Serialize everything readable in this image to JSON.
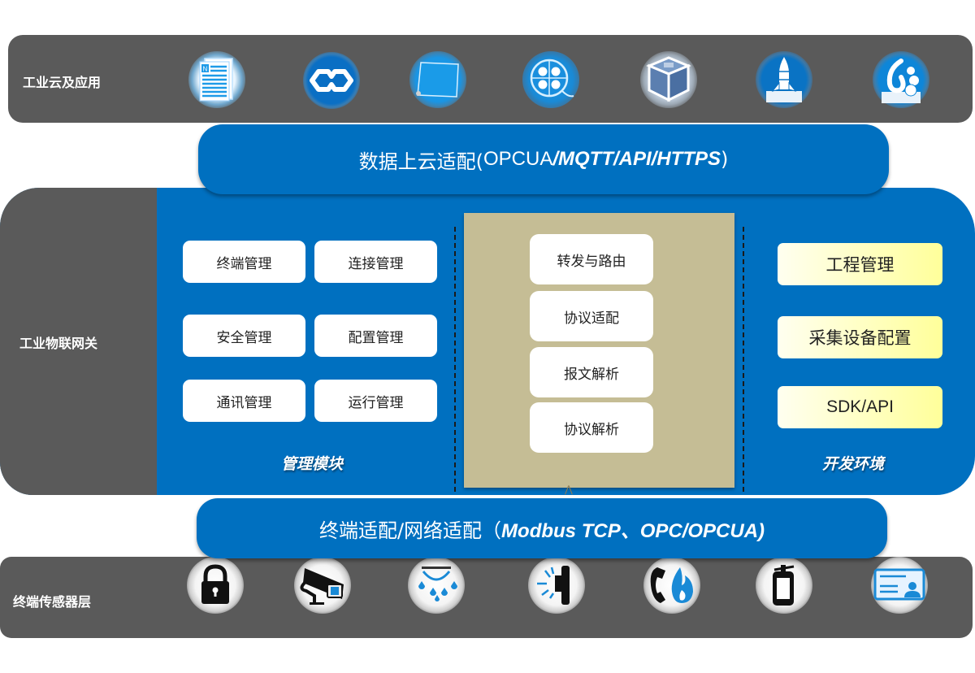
{
  "layers": {
    "cloud": {
      "label": "工业云及应用",
      "icons": [
        {
          "name": "document-icon",
          "glyph": "N"
        },
        {
          "name": "infinity-link-icon",
          "glyph": "∞"
        },
        {
          "name": "blue-screen-icon",
          "glyph": ""
        },
        {
          "name": "film-reel-icon",
          "glyph": ""
        },
        {
          "name": "virtualbox-cube-icon",
          "glyph": ""
        },
        {
          "name": "rocket-launcher-icon",
          "glyph": ""
        },
        {
          "name": "objectdock-icon",
          "glyph": ""
        }
      ]
    },
    "cloud_adapter": {
      "prefix": "数据上云适配(",
      "plain": "OPCUA",
      "italic": "/MQTT/API/HTTPS",
      "suffix": ")"
    },
    "gateway": {
      "label": "工业物联网关",
      "management": {
        "caption": "管理模块",
        "items": [
          "终端管理",
          "连接管理",
          "安全管理",
          "配置管理",
          "通讯管理",
          "运行管理"
        ]
      },
      "core": {
        "items": [
          "转发与路由",
          "协议适配",
          "报文解析",
          "协议解析"
        ]
      },
      "dev_env": {
        "caption": "开发环境",
        "items": [
          "工程管理",
          "采集设备配置",
          "SDK/API"
        ]
      }
    },
    "device_adapter": {
      "prefix": "终端适配/网络适配（",
      "italic": "Modbus TCP、OPC/OPCUA)"
    },
    "sensors": {
      "label": "终端传感器层",
      "icons": [
        {
          "name": "padlock-icon"
        },
        {
          "name": "security-camera-icon"
        },
        {
          "name": "sprinkler-icon"
        },
        {
          "name": "alarm-light-icon"
        },
        {
          "name": "fire-phone-icon"
        },
        {
          "name": "fire-extinguisher-icon"
        },
        {
          "name": "id-card-icon"
        }
      ]
    }
  },
  "colors": {
    "layer_gray": "#5a5a5a",
    "primary_blue": "#0070c0",
    "core_panel": "#c5bd95",
    "dev_button_yellow": "#ffff9a"
  }
}
